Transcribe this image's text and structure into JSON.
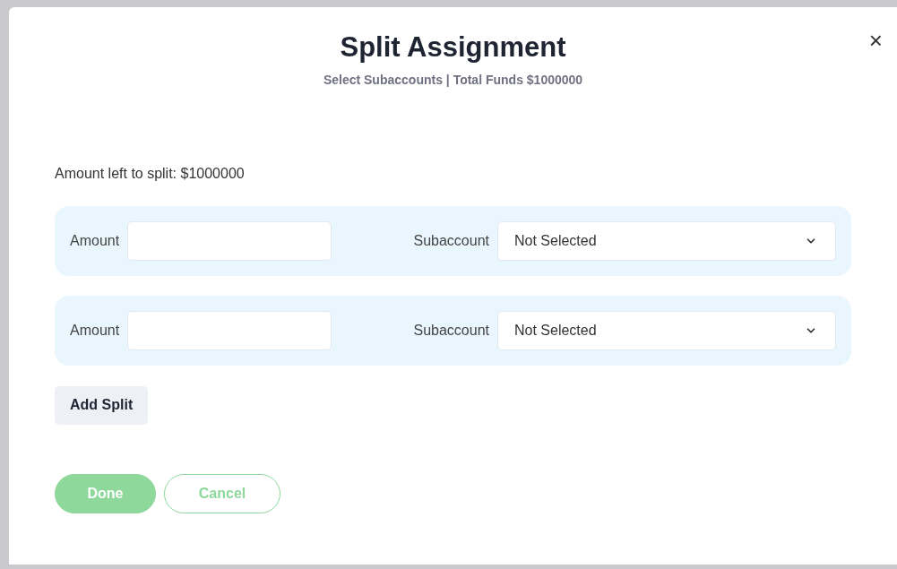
{
  "dialog": {
    "title": "Split Assignment",
    "subtitle": "Select Subaccounts | Total Funds $1000000",
    "close": "×"
  },
  "remaining": "Amount left to split: $1000000",
  "splits": [
    {
      "amount_label": "Amount",
      "subaccount_label": "Subaccount",
      "subaccount_value": "Not Selected"
    },
    {
      "amount_label": "Amount",
      "subaccount_label": "Subaccount",
      "subaccount_value": "Not Selected"
    }
  ],
  "add_button": "Add Split",
  "buttons": [
    {
      "label": "Done",
      "kind": "primary"
    },
    {
      "label": "Cancel",
      "kind": "secondary"
    }
  ]
}
